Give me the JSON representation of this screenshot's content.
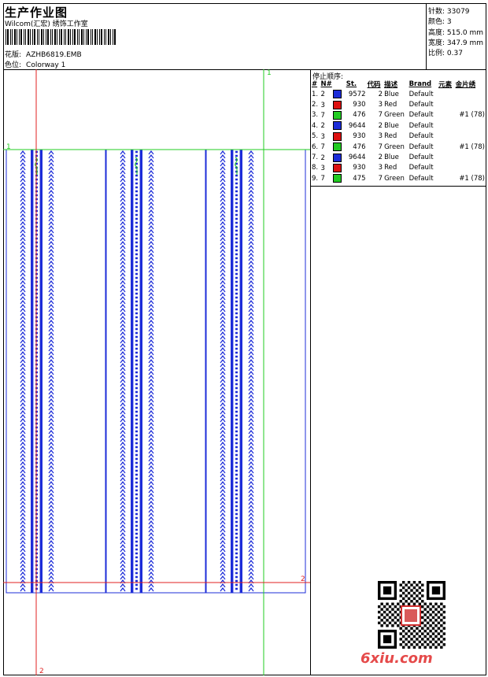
{
  "header": {
    "title": "生产作业图",
    "subtitle": "Wilcom(汇宏) 绣饰工作室",
    "design_label": "花版:",
    "design_value": "AZHB6819.EMB",
    "color_label": "色位:",
    "color_value": "Colorway 1"
  },
  "info": {
    "stitches": "针数: 33079",
    "colors": "颜色: 3",
    "height": "高度: 515.0 mm",
    "width": "宽度: 347.9 mm",
    "scale": "比例: 0.37"
  },
  "stop_sequence": {
    "title": "停止顺序:",
    "columns": [
      "#",
      "N#",
      "St.",
      "代码",
      "描述",
      "Brand",
      "元素",
      "金片绣"
    ],
    "rows": [
      {
        "n": "1.",
        "needle": "2",
        "color": "#1c2cd8",
        "st": "9572",
        "code": "2",
        "desc": "Blue",
        "brand": "Default",
        "elem": "",
        "seq": ""
      },
      {
        "n": "2.",
        "needle": "3",
        "color": "#dd1111",
        "st": "930",
        "code": "3",
        "desc": "Red",
        "brand": "Default",
        "elem": "",
        "seq": ""
      },
      {
        "n": "3.",
        "needle": "7",
        "color": "#22cc22",
        "st": "476",
        "code": "7",
        "desc": "Green",
        "brand": "Default",
        "elem": "",
        "seq": "#1 (78)"
      },
      {
        "n": "4.",
        "needle": "2",
        "color": "#1c2cd8",
        "st": "9644",
        "code": "2",
        "desc": "Blue",
        "brand": "Default",
        "elem": "",
        "seq": ""
      },
      {
        "n": "5.",
        "needle": "3",
        "color": "#dd1111",
        "st": "930",
        "code": "3",
        "desc": "Red",
        "brand": "Default",
        "elem": "",
        "seq": ""
      },
      {
        "n": "6.",
        "needle": "7",
        "color": "#22cc22",
        "st": "476",
        "code": "7",
        "desc": "Green",
        "brand": "Default",
        "elem": "",
        "seq": "#1 (78)"
      },
      {
        "n": "7.",
        "needle": "2",
        "color": "#1c2cd8",
        "st": "9644",
        "code": "2",
        "desc": "Blue",
        "brand": "Default",
        "elem": "",
        "seq": ""
      },
      {
        "n": "8.",
        "needle": "3",
        "color": "#dd1111",
        "st": "930",
        "code": "3",
        "desc": "Red",
        "brand": "Default",
        "elem": "",
        "seq": ""
      },
      {
        "n": "9.",
        "needle": "7",
        "color": "#22cc22",
        "st": "475",
        "code": "7",
        "desc": "Green",
        "brand": "Default",
        "elem": "",
        "seq": "#1 (78)"
      }
    ]
  },
  "markers": {
    "green_top": "1",
    "green_left": "1",
    "red_right": "2",
    "red_bottom": "2"
  },
  "watermark": "6xiu.com",
  "colors": {
    "blue": "#1c2cd8",
    "red": "#dd1111",
    "green": "#22cc22",
    "guide_red": "#e02020",
    "guide_green": "#22cc22"
  }
}
